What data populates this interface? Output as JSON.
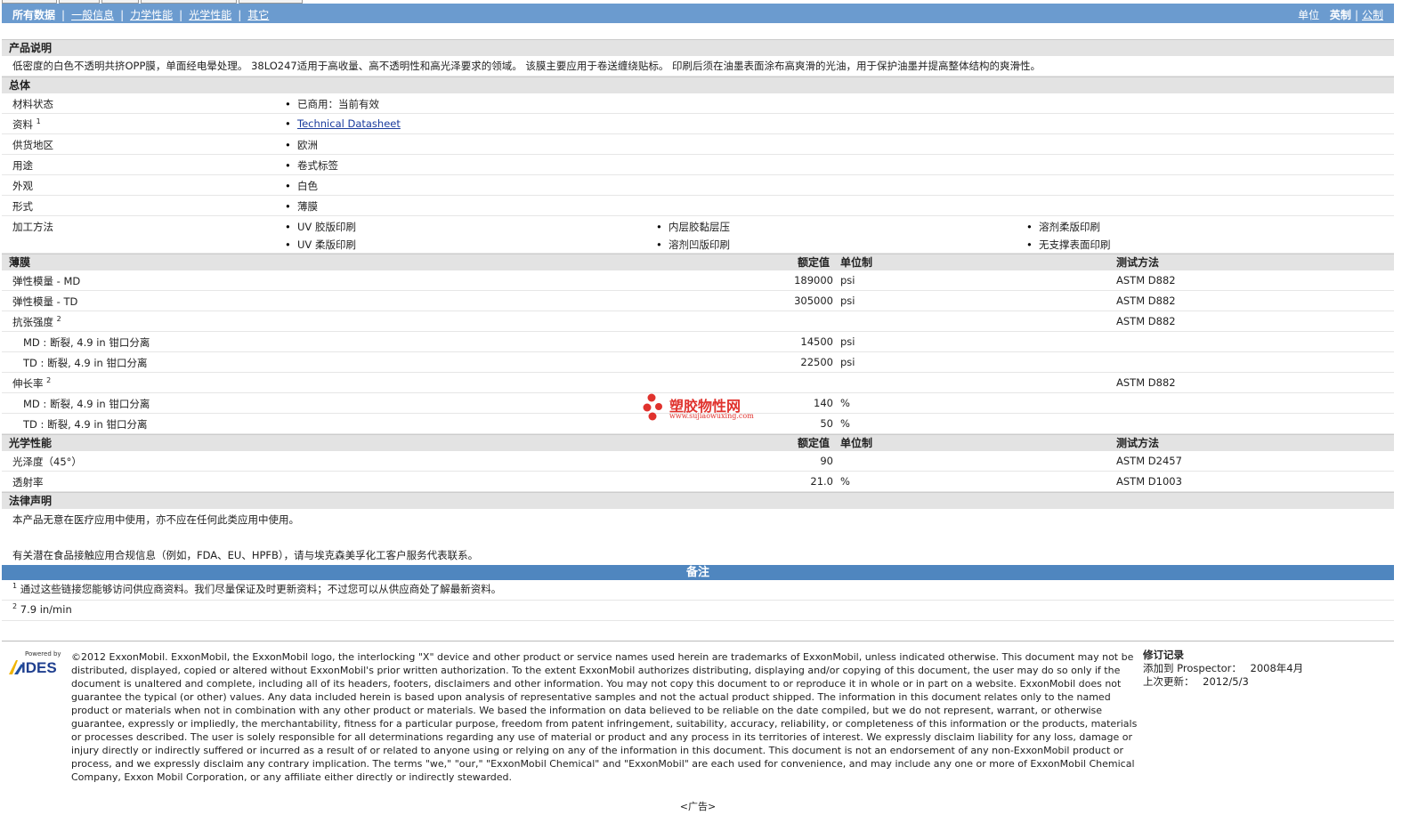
{
  "nav": {
    "all": "所有数据",
    "general": "一般信息",
    "mechanical": "力学性能",
    "optical": "光学性能",
    "other": "其它"
  },
  "units": {
    "label": "单位",
    "english": "英制",
    "metric": "公制"
  },
  "desc_section": {
    "title": "产品说明",
    "text": "低密度的白色不透明共挤OPP膜，单面经电晕处理。 38LO247适用于高收量、高不透明性和高光泽要求的领域。 该膜主要应用于卷送缠绕贴标。 印刷后须在油墨表面涂布高爽滑的光油，用于保护油墨并提高整体结构的爽滑性。"
  },
  "general": {
    "title": "总体",
    "rows": [
      {
        "label": "材料状态",
        "value": "已商用：当前有效"
      },
      {
        "label": "资料",
        "sup": "1",
        "value": "Technical Datasheet"
      },
      {
        "label": "供货地区",
        "value": "欧洲"
      },
      {
        "label": "用途",
        "value": "卷式标签"
      },
      {
        "label": "外观",
        "value": "白色"
      },
      {
        "label": "形式",
        "value": "薄膜"
      }
    ],
    "process_label": "加工方法",
    "process": [
      "UV 胶版印刷",
      "内层胶黏层压",
      "溶剂柔版印刷",
      "UV 柔版印刷",
      "溶剂凹版印刷",
      "无支撑表面印刷"
    ]
  },
  "film": {
    "title": "薄膜",
    "col_value": "额定值",
    "col_unit": "单位制",
    "col_method": "测试方法",
    "rows": [
      {
        "label": "弹性模量 - MD",
        "value": "189000",
        "unit": "psi",
        "method": "ASTM D882",
        "indent": false
      },
      {
        "label": "弹性模量 - TD",
        "value": "305000",
        "unit": "psi",
        "method": "ASTM D882",
        "indent": false
      },
      {
        "label": "抗张强度",
        "sup": "2",
        "value": "",
        "unit": "",
        "method": "ASTM D882",
        "indent": false
      },
      {
        "label": "MD : 断裂, 4.9 in 钳口分离",
        "value": "14500",
        "unit": "psi",
        "method": "",
        "indent": true
      },
      {
        "label": "TD : 断裂, 4.9 in 钳口分离",
        "value": "22500",
        "unit": "psi",
        "method": "",
        "indent": true
      },
      {
        "label": "伸长率",
        "sup": "2",
        "value": "",
        "unit": "",
        "method": "ASTM D882",
        "indent": false
      },
      {
        "label": "MD : 断裂, 4.9 in 钳口分离",
        "value": "140",
        "unit": "%",
        "method": "",
        "indent": true
      },
      {
        "label": "TD : 断裂, 4.9 in 钳口分离",
        "value": "50",
        "unit": "%",
        "method": "",
        "indent": true
      }
    ]
  },
  "optical": {
    "title": "光学性能",
    "col_value": "额定值",
    "col_unit": "单位制",
    "col_method": "测试方法",
    "rows": [
      {
        "label": "光泽度（45°）",
        "value": "90",
        "unit": "",
        "method": "ASTM D2457"
      },
      {
        "label": "透射率",
        "value": "21.0",
        "unit": "%",
        "method": "ASTM D1003"
      }
    ]
  },
  "legal_section": {
    "title": "法律声明",
    "line1": "本产品无意在医疗应用中使用，亦不应在任何此类应用中使用。",
    "line2": "有关潜在食品接触应用合规信息（例如，FDA、EU、HPFB），请与埃克森美孚化工客户服务代表联系。"
  },
  "notes": {
    "title": "备注",
    "items": [
      {
        "num": "1",
        "text": "通过这些链接您能够访问供应商资料。我们尽量保证及时更新资料；不过您可以从供应商处了解最新资料。"
      },
      {
        "num": "2",
        "text": "7.9 in/min"
      }
    ]
  },
  "watermark": {
    "name": "塑胶物性网",
    "url": "www.sujiaowuxing.com"
  },
  "footer": {
    "logo_small": "Powered by",
    "logo": "IDES",
    "legal": "©2012 ExxonMobil. ExxonMobil, the ExxonMobil logo, the interlocking \"X\" device and other product or service names used herein are trademarks of ExxonMobil, unless indicated otherwise. This document may not be distributed, displayed, copied or altered without ExxonMobil's prior written authorization. To the extent ExxonMobil authorizes distributing, displaying and/or copying of this document, the user may do so only if the document is unaltered and complete, including all of its headers, footers, disclaimers and other information. You may not copy this document to or reproduce it in whole or in part on a website. ExxonMobil does not guarantee the typical (or other) values. Any data included herein is based upon analysis of representative samples and not the actual product shipped. The information in this document relates only to the named product or materials when not in combination with any other product or materials. We based the information on data believed to be reliable on the date compiled, but we do not represent, warrant, or otherwise guarantee, expressly or impliedly, the merchantability, fitness for a particular purpose, freedom from patent infringement, suitability, accuracy, reliability, or completeness of this information or the products, materials or processes described. The user is solely responsible for all determinations regarding any use of material or product and any process in its territories of interest. We expressly disclaim liability for any loss, damage or injury directly or indirectly suffered or incurred as a result of or related to anyone using or relying on any of the information in this document. This document is not an endorsement of any non-ExxonMobil product or process, and we expressly disclaim any contrary implication. The terms \"we,\" \"our,\" \"ExxonMobil Chemical\" and \"ExxonMobil\" are each used for convenience, and may include any one or more of ExxonMobil Chemical Company, Exxon Mobil Corporation, or any affiliate either directly or indirectly stewarded.",
    "rev_title": "修订记录",
    "added_label": "添加到 Prospector：",
    "added_value": "2008年4月",
    "updated_label": "上次更新：",
    "updated_value": "2012/5/3"
  },
  "ad": "<广告>"
}
